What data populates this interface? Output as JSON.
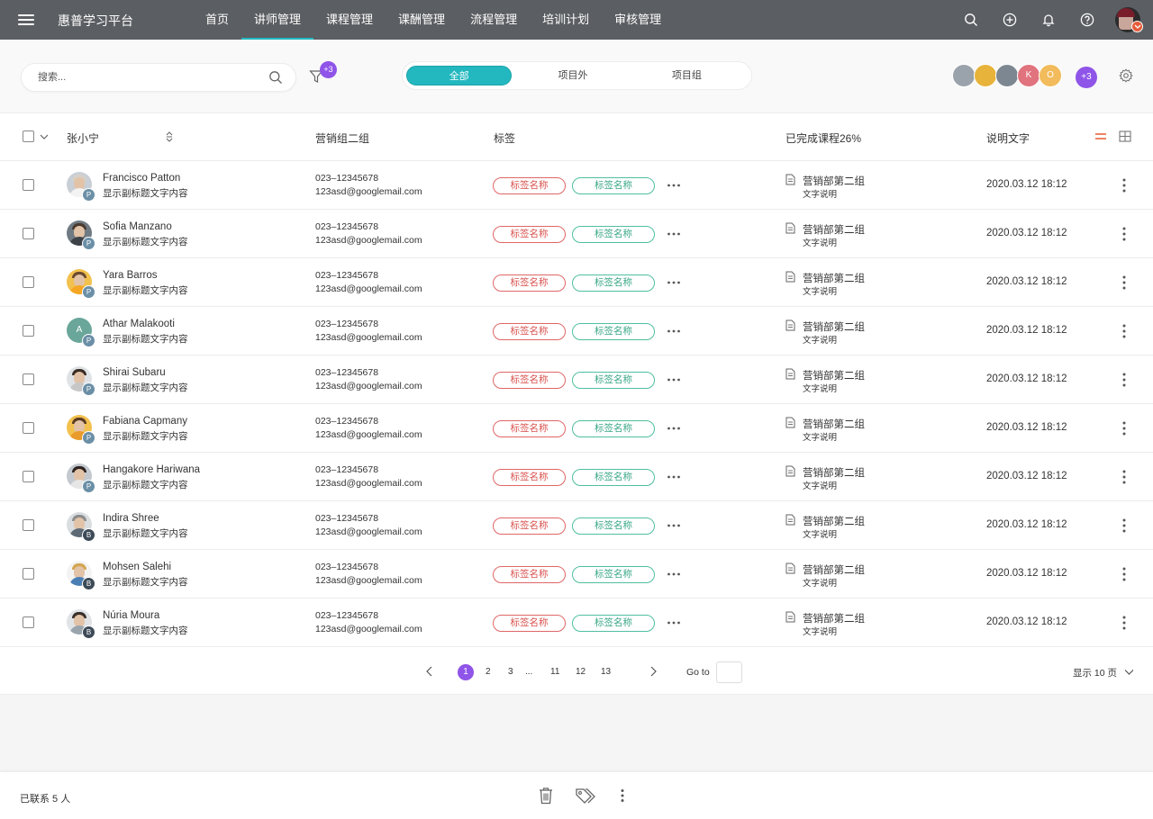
{
  "app": {
    "title": "惠普学习平台"
  },
  "nav": {
    "items": [
      {
        "label": "首页",
        "active": false
      },
      {
        "label": "讲师管理",
        "active": true
      },
      {
        "label": "课程管理",
        "active": false
      },
      {
        "label": "课酬管理",
        "active": false
      },
      {
        "label": "流程管理",
        "active": false
      },
      {
        "label": "培训计划",
        "active": false
      },
      {
        "label": "审核管理",
        "active": false
      }
    ],
    "icons": [
      "search-icon",
      "plus-circle-icon",
      "bell-icon",
      "help-icon"
    ]
  },
  "toolbar": {
    "search_placeholder": "搜索...",
    "filter_badge": "+3",
    "segments": [
      {
        "label": "全部",
        "active": true
      },
      {
        "label": "项目外",
        "active": false
      },
      {
        "label": "项目组",
        "active": false
      }
    ],
    "avatar_letters": [
      "K",
      "O"
    ],
    "more_members": "+3"
  },
  "colors": {
    "accent": "#23b8bf",
    "purple": "#8f54e8",
    "topbar": "#5b5e62",
    "tag_red": "#d9534f",
    "tag_green": "#3aa886",
    "list_view_active": "#e9643c"
  },
  "table": {
    "headers": {
      "name": "张小宁",
      "group": "营销组二组",
      "tags": "标签",
      "completed": "已完成课程26%",
      "description": "说明文字"
    },
    "rows": [
      {
        "name": "Francisco Patton",
        "subtitle": "显示副标题文字内容",
        "badge": "P",
        "phone": "023–12345678",
        "email": "123asd@googlemail.com",
        "tag1": "标签名称",
        "tag2": "标签名称",
        "dept": "营销部第二组",
        "desc": "文字说明",
        "date": "2020.03.12 18:12"
      },
      {
        "name": "Sofia Manzano",
        "subtitle": "显示副标题文字内容",
        "badge": "P",
        "phone": "023–12345678",
        "email": "123asd@googlemail.com",
        "tag1": "标签名称",
        "tag2": "标签名称",
        "dept": "营销部第二组",
        "desc": "文字说明",
        "date": "2020.03.12 18:12"
      },
      {
        "name": "Yara Barros",
        "subtitle": "显示副标题文字内容",
        "badge": "P",
        "phone": "023–12345678",
        "email": "123asd@googlemail.com",
        "tag1": "标签名称",
        "tag2": "标签名称",
        "dept": "营销部第二组",
        "desc": "文字说明",
        "date": "2020.03.12 18:12"
      },
      {
        "name": "Athar Malakooti",
        "subtitle": "显示副标题文字内容",
        "badge": "P",
        "initial": "A",
        "phone": "023–12345678",
        "email": "123asd@googlemail.com",
        "tag1": "标签名称",
        "tag2": "标签名称",
        "dept": "营销部第二组",
        "desc": "文字说明",
        "date": "2020.03.12 18:12"
      },
      {
        "name": "Shirai Subaru",
        "subtitle": "显示副标题文字内容",
        "badge": "P",
        "phone": "023–12345678",
        "email": "123asd@googlemail.com",
        "tag1": "标签名称",
        "tag2": "标签名称",
        "dept": "营销部第二组",
        "desc": "文字说明",
        "date": "2020.03.12 18:12"
      },
      {
        "name": "Fabiana Capmany",
        "subtitle": "显示副标题文字内容",
        "badge": "P",
        "phone": "023–12345678",
        "email": "123asd@googlemail.com",
        "tag1": "标签名称",
        "tag2": "标签名称",
        "dept": "营销部第二组",
        "desc": "文字说明",
        "date": "2020.03.12 18:12"
      },
      {
        "name": "Hangakore Hariwana",
        "subtitle": "显示副标题文字内容",
        "badge": "P",
        "phone": "023–12345678",
        "email": "123asd@googlemail.com",
        "tag1": "标签名称",
        "tag2": "标签名称",
        "dept": "营销部第二组",
        "desc": "文字说明",
        "date": "2020.03.12 18:12"
      },
      {
        "name": "Indira Shree",
        "subtitle": "显示副标题文字内容",
        "badge": "B",
        "phone": "023–12345678",
        "email": "123asd@googlemail.com",
        "tag1": "标签名称",
        "tag2": "标签名称",
        "dept": "营销部第二组",
        "desc": "文字说明",
        "date": "2020.03.12 18:12"
      },
      {
        "name": "Mohsen Salehi",
        "subtitle": "显示副标题文字内容",
        "badge": "B",
        "phone": "023–12345678",
        "email": "123asd@googlemail.com",
        "tag1": "标签名称",
        "tag2": "标签名称",
        "dept": "营销部第二组",
        "desc": "文字说明",
        "date": "2020.03.12 18:12"
      },
      {
        "name": "Núria Moura",
        "subtitle": "显示副标题文字内容",
        "badge": "B",
        "phone": "023–12345678",
        "email": "123asd@googlemail.com",
        "tag1": "标签名称",
        "tag2": "标签名称",
        "dept": "营销部第二组",
        "desc": "文字说明",
        "date": "2020.03.12 18:12"
      }
    ]
  },
  "pagination": {
    "pages": [
      "1",
      "2",
      "3",
      "...",
      "11",
      "12",
      "13"
    ],
    "current": "1",
    "goto_label": "Go to",
    "per_page_label": "显示 10 页"
  },
  "footer": {
    "count_label": "已联系 5 人"
  }
}
